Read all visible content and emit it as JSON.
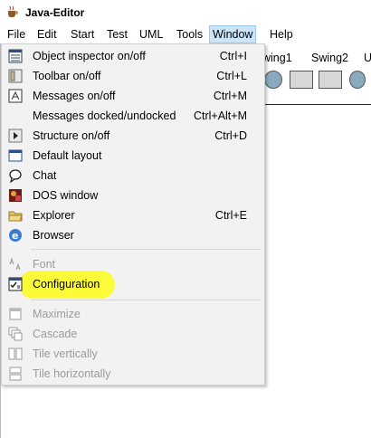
{
  "window": {
    "title": "Java-Editor",
    "icon": "coffee-cup-icon"
  },
  "menubar": {
    "items": [
      "File",
      "Edit",
      "Start",
      "Test",
      "UML",
      "Tools",
      "Window",
      "Help"
    ],
    "active": "Window"
  },
  "background": {
    "tabs": [
      "wing1",
      "Swing2",
      "U"
    ]
  },
  "window_menu": {
    "items": [
      {
        "label": "Object inspector on/off",
        "shortcut": "Ctrl+I",
        "icon": "object-inspector-icon",
        "enabled": true
      },
      {
        "label": "Toolbar on/off",
        "shortcut": "Ctrl+L",
        "icon": "toolbar-icon",
        "enabled": true
      },
      {
        "label": "Messages on/off",
        "shortcut": "Ctrl+M",
        "icon": "messages-icon",
        "enabled": true
      },
      {
        "label": "Messages docked/undocked",
        "shortcut": "Ctrl+Alt+M",
        "icon": "",
        "enabled": true
      },
      {
        "label": "Structure on/off",
        "shortcut": "Ctrl+D",
        "icon": "structure-icon",
        "enabled": true
      },
      {
        "label": "Default layout",
        "shortcut": "",
        "icon": "layout-icon",
        "enabled": true
      },
      {
        "label": "Chat",
        "shortcut": "",
        "icon": "chat-icon",
        "enabled": true
      },
      {
        "label": "DOS window",
        "shortcut": "",
        "icon": "dos-window-icon",
        "enabled": true
      },
      {
        "label": "Explorer",
        "shortcut": "Ctrl+E",
        "icon": "folder-icon",
        "enabled": true
      },
      {
        "label": "Browser",
        "shortcut": "",
        "icon": "browser-icon",
        "enabled": true
      },
      {
        "label": "Font",
        "shortcut": "",
        "icon": "font-icon",
        "enabled": false
      },
      {
        "label": "Configuration",
        "shortcut": "",
        "icon": "configuration-icon",
        "enabled": true
      },
      {
        "label": "Maximize",
        "shortcut": "",
        "icon": "maximize-icon",
        "enabled": false
      },
      {
        "label": "Cascade",
        "shortcut": "",
        "icon": "cascade-icon",
        "enabled": false
      },
      {
        "label": "Tile vertically",
        "shortcut": "",
        "icon": "tile-vertical-icon",
        "enabled": false
      },
      {
        "label": "Tile horizontally",
        "shortcut": "",
        "icon": "tile-horizontal-icon",
        "enabled": false
      }
    ]
  },
  "colors": {
    "menu_bg": "#f2f2f2",
    "active_menu_bg": "#cce4f7",
    "highlight": "#fbfb3a",
    "disabled_text": "#9a9a9a"
  }
}
